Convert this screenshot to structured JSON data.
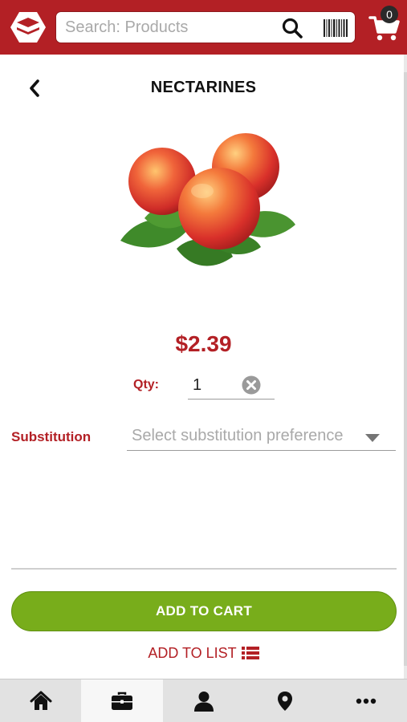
{
  "header": {
    "search_placeholder": "Search: Products",
    "cart_count": "0"
  },
  "product": {
    "title": "NECTARINES",
    "price": "$2.39",
    "qty_label": "Qty:",
    "qty_value": "1",
    "substitution_label": "Substitution",
    "substitution_placeholder": "Select substitution preference"
  },
  "actions": {
    "add_to_cart": "ADD TO CART",
    "add_to_list": "ADD TO LIST"
  },
  "bottom_nav": {
    "items": [
      "home-icon",
      "briefcase-icon",
      "user-icon",
      "location-pin-icon",
      "more-icon"
    ],
    "active": "briefcase-icon"
  },
  "colors": {
    "brand_red": "#b32025",
    "accent_green": "#78ad1b"
  }
}
